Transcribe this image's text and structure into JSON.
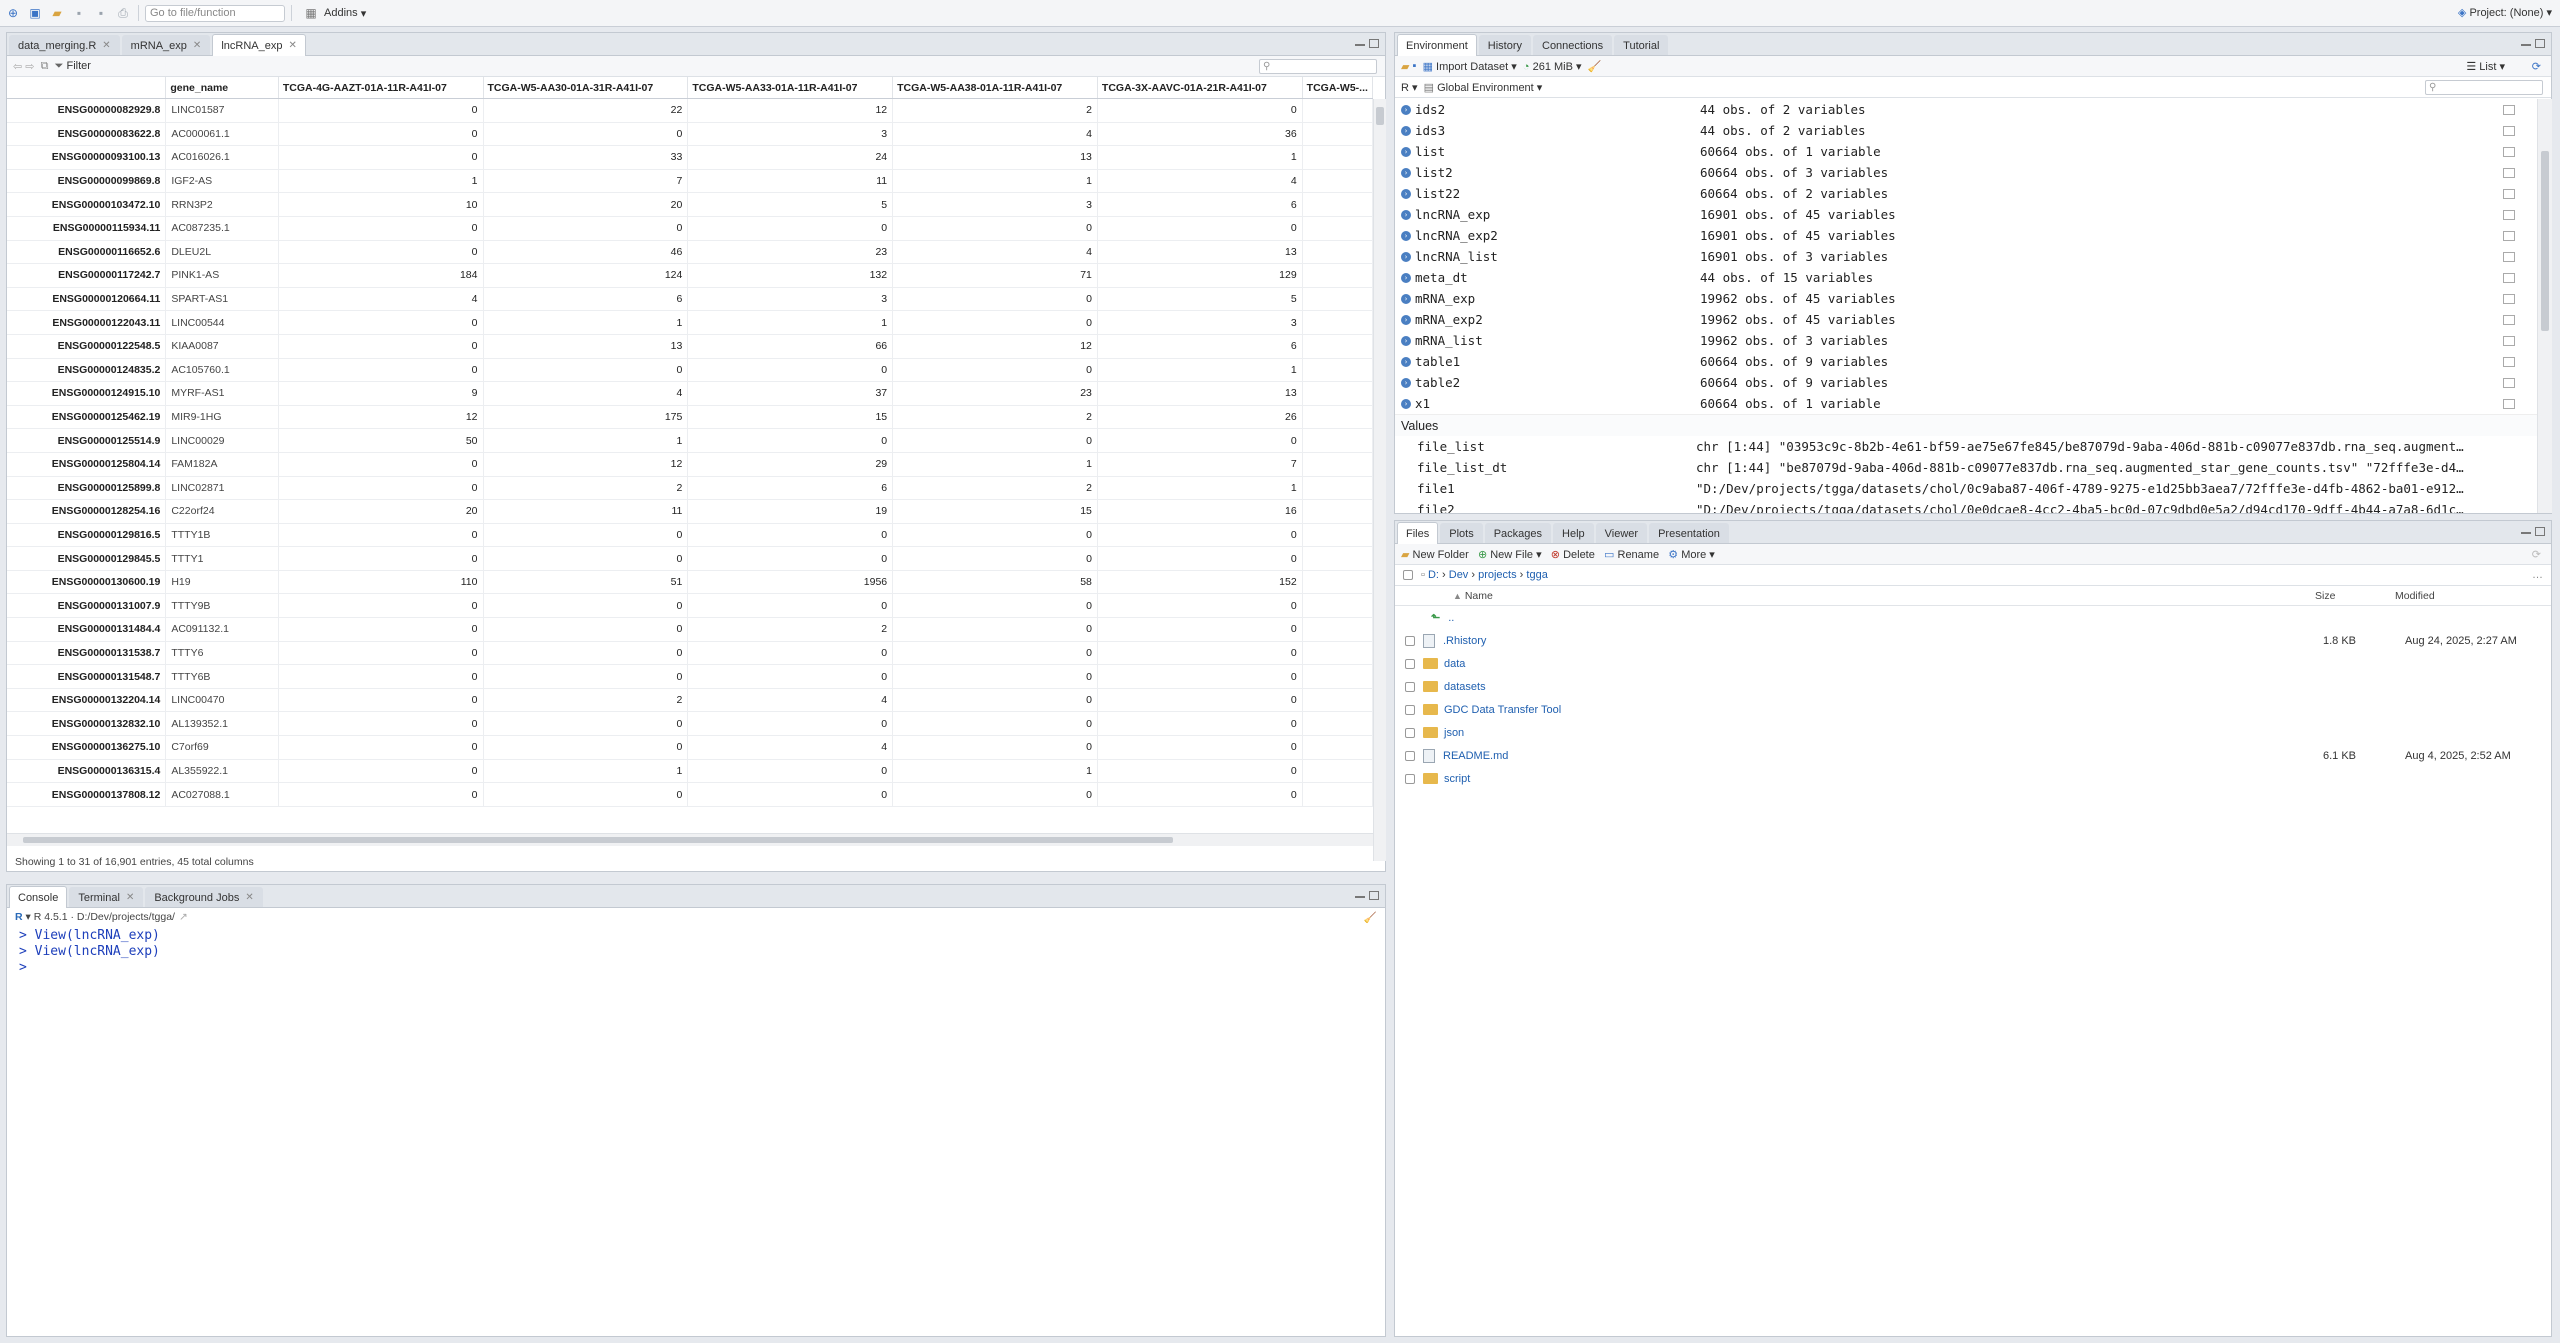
{
  "toolbar": {
    "goto_placeholder": "Go to file/function",
    "addins_label": "Addins",
    "project_label": "Project: (None)"
  },
  "source_pane": {
    "tabs": [
      {
        "label": "data_merging.R",
        "active": false
      },
      {
        "label": "mRNA_exp",
        "active": false
      },
      {
        "label": "lncRNA_exp",
        "active": true
      }
    ],
    "filter_label": "Filter",
    "columns": [
      "",
      "gene_name",
      "TCGA-4G-AAZT-01A-11R-A41I-07",
      "TCGA-W5-AA30-01A-31R-A41I-07",
      "TCGA-W5-AA33-01A-11R-A41I-07",
      "TCGA-W5-AA38-01A-11R-A41I-07",
      "TCGA-3X-AAVC-01A-21R-A41I-07",
      "TCGA-W5-..."
    ],
    "rows": [
      [
        "ENSG00000082929.8",
        "LINC01587",
        "0",
        "22",
        "12",
        "2",
        "0"
      ],
      [
        "ENSG00000083622.8",
        "AC000061.1",
        "0",
        "0",
        "3",
        "4",
        "36"
      ],
      [
        "ENSG00000093100.13",
        "AC016026.1",
        "0",
        "33",
        "24",
        "13",
        "1"
      ],
      [
        "ENSG00000099869.8",
        "IGF2-AS",
        "1",
        "7",
        "11",
        "1",
        "4"
      ],
      [
        "ENSG00000103472.10",
        "RRN3P2",
        "10",
        "20",
        "5",
        "3",
        "6"
      ],
      [
        "ENSG00000115934.11",
        "AC087235.1",
        "0",
        "0",
        "0",
        "0",
        "0"
      ],
      [
        "ENSG00000116652.6",
        "DLEU2L",
        "0",
        "46",
        "23",
        "4",
        "13"
      ],
      [
        "ENSG00000117242.7",
        "PINK1-AS",
        "184",
        "124",
        "132",
        "71",
        "129"
      ],
      [
        "ENSG00000120664.11",
        "SPART-AS1",
        "4",
        "6",
        "3",
        "0",
        "5"
      ],
      [
        "ENSG00000122043.11",
        "LINC00544",
        "0",
        "1",
        "1",
        "0",
        "3"
      ],
      [
        "ENSG00000122548.5",
        "KIAA0087",
        "0",
        "13",
        "66",
        "12",
        "6"
      ],
      [
        "ENSG00000124835.2",
        "AC105760.1",
        "0",
        "0",
        "0",
        "0",
        "1"
      ],
      [
        "ENSG00000124915.10",
        "MYRF-AS1",
        "9",
        "4",
        "37",
        "23",
        "13"
      ],
      [
        "ENSG00000125462.19",
        "MIR9-1HG",
        "12",
        "175",
        "15",
        "2",
        "26"
      ],
      [
        "ENSG00000125514.9",
        "LINC00029",
        "50",
        "1",
        "0",
        "0",
        "0"
      ],
      [
        "ENSG00000125804.14",
        "FAM182A",
        "0",
        "12",
        "29",
        "1",
        "7"
      ],
      [
        "ENSG00000125899.8",
        "LINC02871",
        "0",
        "2",
        "6",
        "2",
        "1"
      ],
      [
        "ENSG00000128254.16",
        "C22orf24",
        "20",
        "11",
        "19",
        "15",
        "16"
      ],
      [
        "ENSG00000129816.5",
        "TTTY1B",
        "0",
        "0",
        "0",
        "0",
        "0"
      ],
      [
        "ENSG00000129845.5",
        "TTTY1",
        "0",
        "0",
        "0",
        "0",
        "0"
      ],
      [
        "ENSG00000130600.19",
        "H19",
        "110",
        "51",
        "1956",
        "58",
        "152"
      ],
      [
        "ENSG00000131007.9",
        "TTTY9B",
        "0",
        "0",
        "0",
        "0",
        "0"
      ],
      [
        "ENSG00000131484.4",
        "AC091132.1",
        "0",
        "0",
        "2",
        "0",
        "0"
      ],
      [
        "ENSG00000131538.7",
        "TTTY6",
        "0",
        "0",
        "0",
        "0",
        "0"
      ],
      [
        "ENSG00000131548.7",
        "TTTY6B",
        "0",
        "0",
        "0",
        "0",
        "0"
      ],
      [
        "ENSG00000132204.14",
        "LINC00470",
        "0",
        "2",
        "4",
        "0",
        "0"
      ],
      [
        "ENSG00000132832.10",
        "AL139352.1",
        "0",
        "0",
        "0",
        "0",
        "0"
      ],
      [
        "ENSG00000136275.10",
        "C7orf69",
        "0",
        "0",
        "4",
        "0",
        "0"
      ],
      [
        "ENSG00000136315.4",
        "AL355922.1",
        "0",
        "1",
        "0",
        "1",
        "0"
      ],
      [
        "ENSG00000137808.12",
        "AC027088.1",
        "0",
        "0",
        "0",
        "0",
        "0"
      ]
    ],
    "status": "Showing 1 to 31 of 16,901 entries, 45 total columns"
  },
  "console_pane": {
    "tabs": [
      "Console",
      "Terminal",
      "Background Jobs"
    ],
    "r_version": "R 4.5.1",
    "path": "D:/Dev/projects/tgga/",
    "lines": [
      "> View(lncRNA_exp)",
      "> View(lncRNA_exp)",
      "> "
    ]
  },
  "env_pane": {
    "tabs": [
      "Environment",
      "History",
      "Connections",
      "Tutorial"
    ],
    "import_label": "Import Dataset",
    "memory_label": "261 MiB",
    "list_label": "List",
    "lang_label": "R",
    "scope_label": "Global Environment",
    "data": [
      {
        "name": "ids2",
        "value": "44 obs. of 2 variables"
      },
      {
        "name": "ids3",
        "value": "44 obs. of 2 variables"
      },
      {
        "name": "list",
        "value": "60664 obs. of 1 variable"
      },
      {
        "name": "list2",
        "value": "60664 obs. of 3 variables"
      },
      {
        "name": "list22",
        "value": "60664 obs. of 2 variables"
      },
      {
        "name": "lncRNA_exp",
        "value": "16901 obs. of 45 variables"
      },
      {
        "name": "lncRNA_exp2",
        "value": "16901 obs. of 45 variables"
      },
      {
        "name": "lncRNA_list",
        "value": "16901 obs. of 3 variables"
      },
      {
        "name": "meta_dt",
        "value": "44 obs. of 15 variables"
      },
      {
        "name": "mRNA_exp",
        "value": "19962 obs. of 45 variables"
      },
      {
        "name": "mRNA_exp2",
        "value": "19962 obs. of 45 variables"
      },
      {
        "name": "mRNA_list",
        "value": "19962 obs. of 3 variables"
      },
      {
        "name": "table1",
        "value": "60664 obs. of 9 variables"
      },
      {
        "name": "table2",
        "value": "60664 obs. of 9 variables"
      },
      {
        "name": "x1",
        "value": "60664 obs. of 1 variable"
      }
    ],
    "values_header": "Values",
    "values": [
      {
        "name": "file_list",
        "value": "chr [1:44] \"03953c9c-8b2b-4e61-bf59-ae75e67fe845/be87079d-9aba-406d-881b-c09077e837db.rna_seq.augment…"
      },
      {
        "name": "file_list_dt",
        "value": "chr [1:44] \"be87079d-9aba-406d-881b-c09077e837db.rna_seq.augmented_star_gene_counts.tsv\" \"72fffe3e-d4…"
      },
      {
        "name": "file1",
        "value": "\"D:/Dev/projects/tgga/datasets/chol/0c9aba87-406f-4789-9275-e1d25bb3aea7/72fffe3e-d4fb-4862-ba01-e912…"
      },
      {
        "name": "file2",
        "value": "\"D:/Dev/projects/tgga/datasets/chol/0e0dcae8-4cc2-4ba5-bc0d-07c9dbd0e5a2/d94cd170-9dff-4b44-a7a8-6d1c…"
      }
    ]
  },
  "files_pane": {
    "tabs": [
      "Files",
      "Plots",
      "Packages",
      "Help",
      "Viewer",
      "Presentation"
    ],
    "actions": [
      "New Folder",
      "New File",
      "Delete",
      "Rename",
      "More"
    ],
    "breadcrumb": [
      "D:",
      "Dev",
      "projects",
      "tgga"
    ],
    "headers": {
      "name": "Name",
      "size": "Size",
      "modified": "Modified"
    },
    "up_label": "..",
    "items": [
      {
        "name": ".Rhistory",
        "type": "file",
        "size": "1.8 KB",
        "modified": "Aug 24, 2025, 2:27 AM"
      },
      {
        "name": "data",
        "type": "folder",
        "size": "",
        "modified": ""
      },
      {
        "name": "datasets",
        "type": "folder",
        "size": "",
        "modified": ""
      },
      {
        "name": "GDC Data Transfer Tool",
        "type": "folder",
        "size": "",
        "modified": ""
      },
      {
        "name": "json",
        "type": "folder",
        "size": "",
        "modified": ""
      },
      {
        "name": "README.md",
        "type": "file",
        "size": "6.1 KB",
        "modified": "Aug 4, 2025, 2:52 AM"
      },
      {
        "name": "script",
        "type": "folder",
        "size": "",
        "modified": ""
      }
    ]
  }
}
